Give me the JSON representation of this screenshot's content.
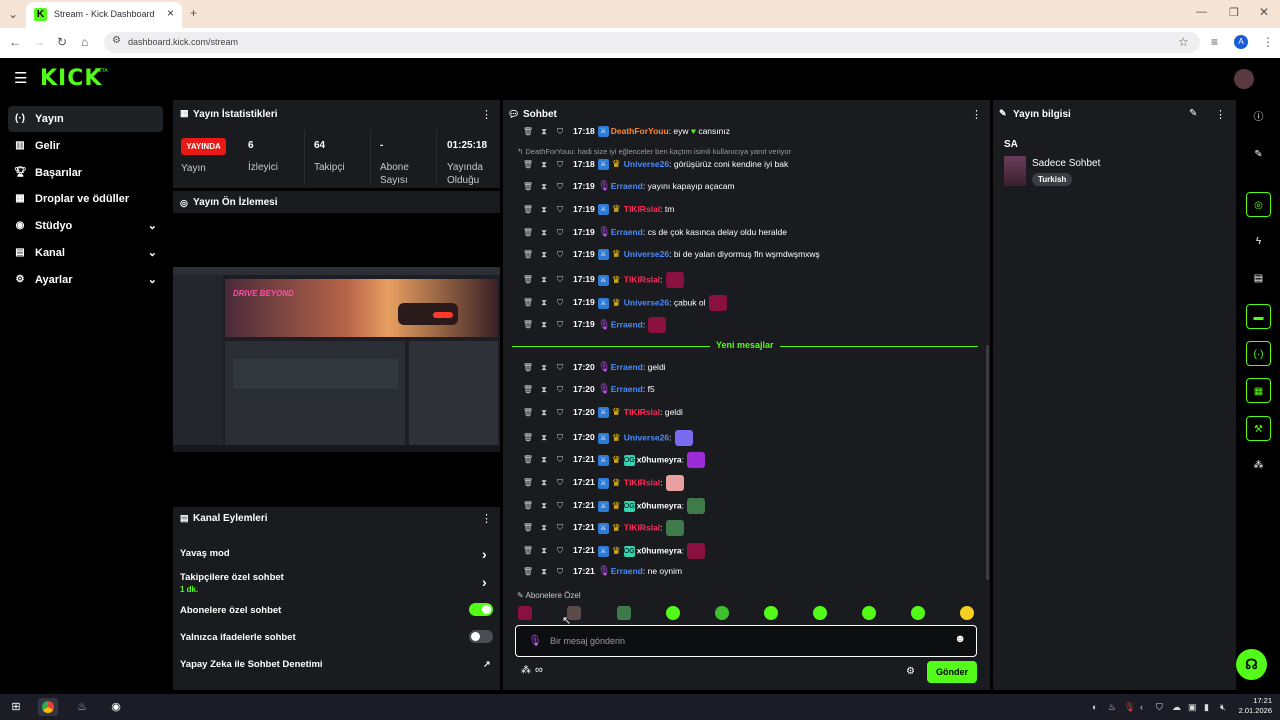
{
  "browser": {
    "tab_title": "Stream - Kick Dashboard",
    "url": "dashboard.kick.com/stream",
    "profile_initial": "A"
  },
  "header": {
    "logo": "KICK",
    "beta": "BETA"
  },
  "sidebar": {
    "items": [
      {
        "label": "Yayın",
        "icon": "broadcast-icon",
        "active": true,
        "chevron": false
      },
      {
        "label": "Gelir",
        "icon": "revenue-icon",
        "active": false,
        "chevron": false
      },
      {
        "label": "Başarılar",
        "icon": "trophy-icon",
        "active": false,
        "chevron": false
      },
      {
        "label": "Droplar ve ödüller",
        "icon": "drops-icon",
        "active": false,
        "chevron": false
      },
      {
        "label": "Stüdyo",
        "icon": "studio-icon",
        "active": false,
        "chevron": true
      },
      {
        "label": "Kanal",
        "icon": "channel-icon",
        "active": false,
        "chevron": true
      },
      {
        "label": "Ayarlar",
        "icon": "settings-icon",
        "active": false,
        "chevron": true
      }
    ]
  },
  "stats": {
    "title": "Yayın İstatistikleri",
    "live_badge": "YAYINDA",
    "live_label": "Yayın",
    "cols": [
      {
        "value": "6",
        "label": "İzleyici"
      },
      {
        "value": "64",
        "label": "Takipçi"
      },
      {
        "value": "-",
        "label": "Abone Sayısı"
      },
      {
        "value": "01:25:18",
        "label": "Yayında Olduğu"
      }
    ]
  },
  "preview": {
    "title": "Yayın Ön İzlemesi",
    "overlay_text": "DRIVE BEYOND"
  },
  "actions": {
    "title": "Kanal Eylemleri",
    "slow_mode": "Yavaş mod",
    "followers_only": "Takipçilere özel sohbet",
    "followers_only_sub": "1 dk.",
    "subs_only": "Abonelere özel sohbet",
    "subs_only_on": true,
    "emotes_only": "Yalnızca ifadelerle sohbet",
    "emotes_only_on": false,
    "ai_mod": "Yapay Zeka ile Sohbet Denetimi"
  },
  "chat": {
    "title": "Sohbet",
    "reply_line": "DeathForYouu: hadi size iyi eğlenceler ben kaçtım isimli kullanıcıya yanıt veriyor",
    "new_messages": "Yeni mesajlar",
    "subs_only_label": "Abonelere Özel",
    "input_placeholder": "Bir mesaj gönderin",
    "send": "Gönder",
    "messages": [
      {
        "time": "17:18",
        "user": "DeathForYouu",
        "color": "#ff8a2a",
        "badges": [
          "mod"
        ],
        "text": ": eyw",
        "extra": "cansınız",
        "heart": true
      },
      {
        "time": "17:18",
        "user": "Universe26",
        "color": "#4a8cff",
        "badges": [
          "mod",
          "vip"
        ],
        "text": ": görüşürüz coni kendine iyi bak"
      },
      {
        "time": "17:19",
        "user": "Erraend",
        "color": "#4a8cff",
        "badges": [
          "mic"
        ],
        "text": ": yayını kapayıp açacam"
      },
      {
        "time": "17:19",
        "user": "TIKIRslal",
        "color": "#ff2a55",
        "badges": [
          "mod",
          "vip"
        ],
        "text": ": tm"
      },
      {
        "time": "17:19",
        "user": "Erraend",
        "color": "#4a8cff",
        "badges": [
          "mic"
        ],
        "text": ": cs de çok kasınca delay oldu heralde"
      },
      {
        "time": "17:19",
        "user": "Universe26",
        "color": "#4a8cff",
        "badges": [
          "mod",
          "vip"
        ],
        "text": ": bi de yalan diyormuş fln wşmdwşmxwş"
      },
      {
        "time": "17:19",
        "user": "TIKIRslal",
        "color": "#ff2a55",
        "badges": [
          "mod",
          "vip"
        ],
        "text": ":",
        "emote": "#8a1040"
      },
      {
        "time": "17:19",
        "user": "Universe26",
        "color": "#4a8cff",
        "badges": [
          "mod",
          "vip"
        ],
        "text": ": çabuk ol",
        "emote": "#8a1040"
      },
      {
        "time": "17:19",
        "user": "Erraend",
        "color": "#4a8cff",
        "badges": [
          "mic"
        ],
        "text": ":",
        "emote": "#8a1040"
      },
      {
        "time": "17:20",
        "user": "Erraend",
        "color": "#4a8cff",
        "badges": [
          "mic"
        ],
        "text": ": geldi"
      },
      {
        "time": "17:20",
        "user": "Erraend",
        "color": "#4a8cff",
        "badges": [
          "mic"
        ],
        "text": ": f5"
      },
      {
        "time": "17:20",
        "user": "TIKIRslal",
        "color": "#ff2a55",
        "badges": [
          "mod",
          "vip"
        ],
        "text": ": geldi"
      },
      {
        "time": "17:20",
        "user": "Universe26",
        "color": "#4a8cff",
        "badges": [
          "mod",
          "vip"
        ],
        "text": ":",
        "emote": "#7a6cf0"
      },
      {
        "time": "17:21",
        "user": "x0humeyra",
        "color": "#ffffff",
        "badges": [
          "mod",
          "vip",
          "og"
        ],
        "text": ":",
        "emote": "#9c2bd8"
      },
      {
        "time": "17:21",
        "user": "TIKIRslal",
        "color": "#ff2a55",
        "badges": [
          "mod",
          "vip"
        ],
        "text": ":",
        "emote": "#e8a0a0"
      },
      {
        "time": "17:21",
        "user": "x0humeyra",
        "color": "#ffffff",
        "badges": [
          "mod",
          "vip",
          "og"
        ],
        "text": ":",
        "emote": "#3f7a4a"
      },
      {
        "time": "17:21",
        "user": "TIKIRslal",
        "color": "#ff2a55",
        "badges": [
          "mod",
          "vip"
        ],
        "text": ":",
        "emote": "#3f7a4a"
      },
      {
        "time": "17:21",
        "user": "x0humeyra",
        "color": "#ffffff",
        "badges": [
          "mod",
          "vip",
          "og"
        ],
        "text": ":",
        "emote": "#8a1040"
      },
      {
        "time": "17:21",
        "user": "Erraend",
        "color": "#4a8cff",
        "badges": [
          "mic"
        ],
        "text": ": ne oynim"
      }
    ]
  },
  "info": {
    "title": "Yayın bilgisi",
    "stream_title": "SA",
    "category": "Sadece Sohbet",
    "tag": "Turkish"
  },
  "taskbar": {
    "time": "17:21",
    "date": "2.01.2026"
  }
}
